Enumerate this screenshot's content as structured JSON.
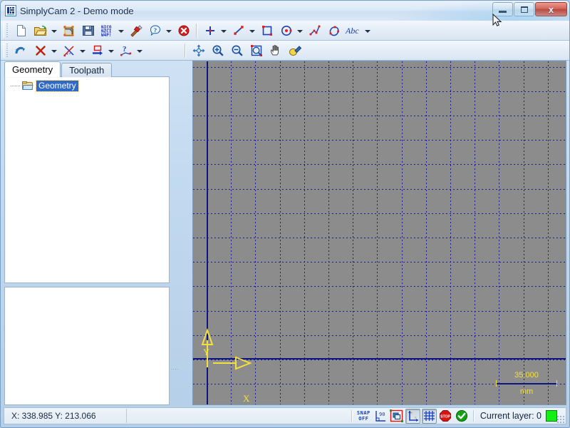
{
  "window": {
    "title": "SimplyCam 2 - Demo mode",
    "icon": "app-icon",
    "minimize_label": "",
    "maximize_label": "",
    "close_label": "x"
  },
  "toolbar_rows": [
    {
      "name": "standard-toolbar",
      "items": [
        {
          "icon": "new-file-icon",
          "label": "New",
          "dropdown": false
        },
        {
          "icon": "open-folder-icon",
          "label": "Open",
          "dropdown": true
        },
        {
          "icon": "import-geometry-icon",
          "label": "Import",
          "dropdown": false
        },
        {
          "icon": "save-icon",
          "label": "Save",
          "dropdown": false
        },
        {
          "icon": "nc-code-icon",
          "label": "NC Code",
          "dropdown": true
        },
        {
          "icon": "hammer-tool-icon",
          "label": "Tools",
          "dropdown": false
        },
        {
          "icon": "help-icon",
          "label": "Help",
          "dropdown": true
        },
        {
          "icon": "delete-all-icon",
          "label": "Delete",
          "dropdown": false
        },
        {
          "icon": "separator",
          "label": "",
          "dropdown": false
        },
        {
          "icon": "point-icon",
          "label": "Point",
          "dropdown": true
        },
        {
          "icon": "line-icon",
          "label": "Line",
          "dropdown": true
        },
        {
          "icon": "rectangle-icon",
          "label": "Rectangle",
          "dropdown": false
        },
        {
          "icon": "circle-icon",
          "label": "Circle",
          "dropdown": true
        },
        {
          "icon": "polyline-icon",
          "label": "Polyline",
          "dropdown": false
        },
        {
          "icon": "spline-icon",
          "label": "Spline",
          "dropdown": false
        },
        {
          "icon": "text-abc-icon",
          "label": "Abc",
          "dropdown": true
        }
      ]
    },
    {
      "name": "edit-view-toolbar",
      "items": [
        {
          "icon": "undo-icon",
          "label": "Undo",
          "dropdown": false
        },
        {
          "icon": "erase-icon",
          "label": "Erase",
          "dropdown": true
        },
        {
          "icon": "trim-icon",
          "label": "Trim",
          "dropdown": true
        },
        {
          "icon": "offset-icon",
          "label": "Offset",
          "dropdown": true
        },
        {
          "icon": "measure-icon",
          "label": "Measure",
          "dropdown": true
        },
        {
          "icon": "separator",
          "label": "",
          "dropdown": false
        },
        {
          "icon": "pan-move-icon",
          "label": "Move view",
          "dropdown": false
        },
        {
          "icon": "zoom-in-icon",
          "label": "Zoom in",
          "dropdown": false
        },
        {
          "icon": "zoom-out-icon",
          "label": "Zoom out",
          "dropdown": false
        },
        {
          "icon": "zoom-window-icon",
          "label": "Zoom window",
          "dropdown": false
        },
        {
          "icon": "hand-pan-icon",
          "label": "Pan",
          "dropdown": false
        },
        {
          "icon": "clean-screen-icon",
          "label": "Redraw",
          "dropdown": false
        }
      ]
    }
  ],
  "sidebar": {
    "tabs": [
      {
        "label": "Geometry",
        "active": true
      },
      {
        "label": "Toolpath",
        "active": false
      }
    ],
    "tree": {
      "root_label": "Geometry",
      "root_icon": "open-folder-icon",
      "selected": true
    }
  },
  "canvas": {
    "axis_label_x": "X",
    "axis_label_y": "Y",
    "scale_value": "35.000",
    "scale_unit": "mm",
    "background_color": "#8c8c8c",
    "grid_color": "#1b1b96",
    "axis_color": "#0b1680",
    "marker_color": "#f3e03a"
  },
  "statusbar": {
    "coordinates": "X: 338.985 Y: 213.066",
    "snap_line1": "SNAP",
    "snap_line2": "OFF",
    "angle_label": "90",
    "buttons": [
      {
        "name": "snap-toggle-button",
        "pressed": false
      },
      {
        "name": "angle-snap-button",
        "pressed": false
      },
      {
        "name": "group-select-button",
        "pressed": false
      },
      {
        "name": "show-axes-button",
        "pressed": true
      },
      {
        "name": "show-grid-button",
        "pressed": true
      },
      {
        "name": "stop-button",
        "pressed": false
      },
      {
        "name": "accept-button",
        "pressed": false
      }
    ],
    "layer_label": "Current layer: 0",
    "layer_color": "#13f013"
  }
}
